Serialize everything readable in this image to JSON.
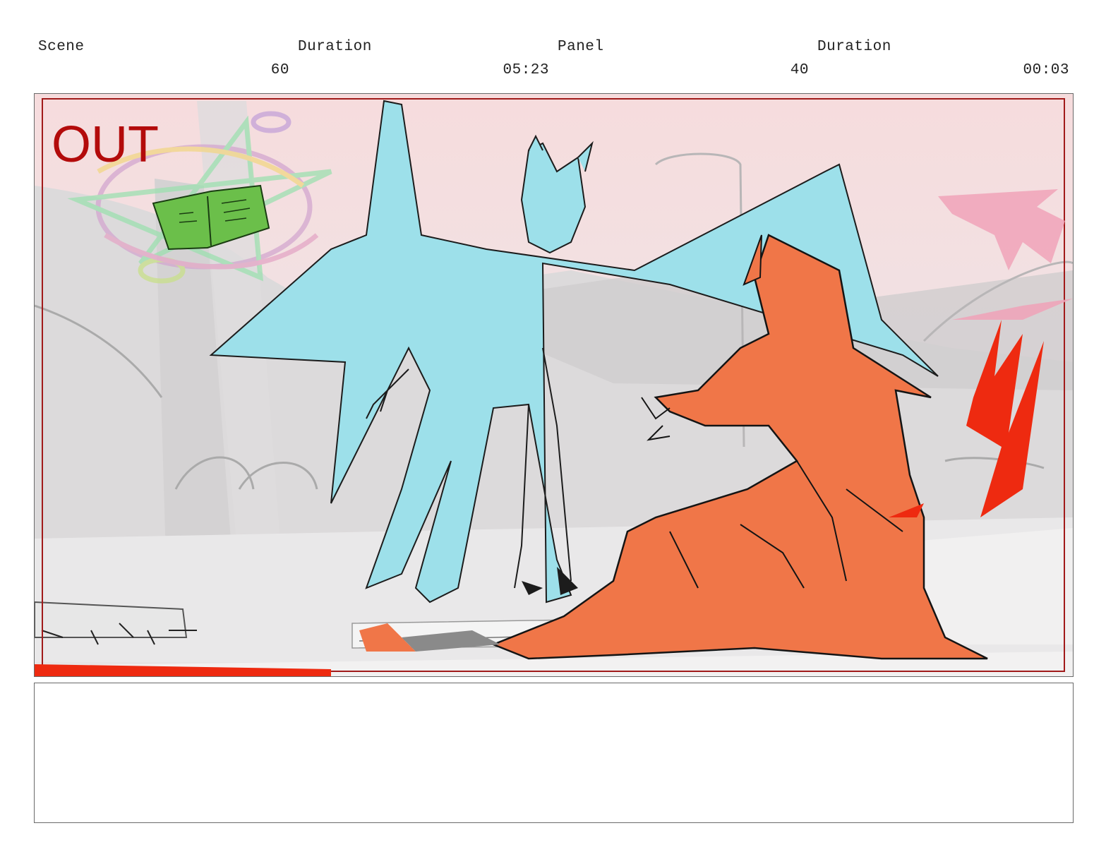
{
  "header": {
    "scene_label": "Scene",
    "scene_duration_label": "Duration",
    "panel_label": "Panel",
    "panel_duration_label": "Duration",
    "scene_number": "60",
    "scene_duration": "05:23",
    "panel_number": "40",
    "panel_duration": "00:03"
  },
  "panel": {
    "out_label": "OUT",
    "colors": {
      "background": "#f6dfe0",
      "frame_line": "#a11a1a",
      "out_text": "#b30b0b",
      "blue_figure": "#9de0ea",
      "orange_figure": "#f07648",
      "book": "#6bbf4a",
      "red_slash": "#ee2a10",
      "pink_effect": "#f0a3b8",
      "set_gray": "#d9d7d8"
    }
  },
  "notes": {
    "text": ""
  }
}
